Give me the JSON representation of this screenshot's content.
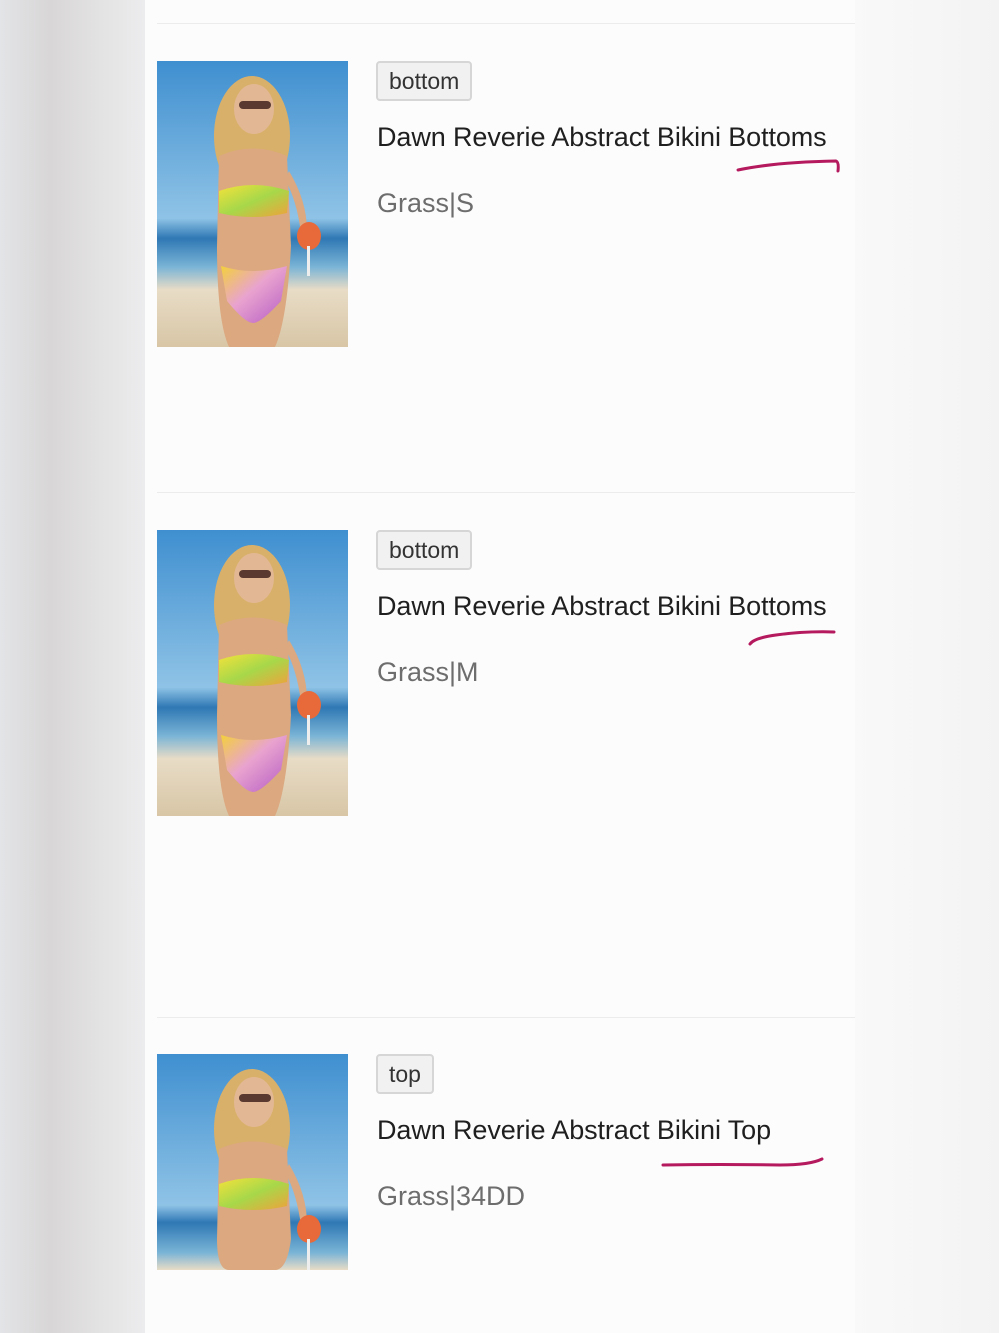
{
  "cart_items": [
    {
      "tag": "bottom",
      "title": "Dawn Reverie Abstract Bikini Bottoms",
      "variant": "Grass|S"
    },
    {
      "tag": "bottom",
      "title": "Dawn Reverie Abstract Bikini Bottoms",
      "variant": "Grass|M"
    },
    {
      "tag": "top",
      "title": "Dawn Reverie Abstract Bikini Top",
      "variant": "Grass|34DD"
    }
  ],
  "colors": {
    "annotation_stroke": "#b5195e",
    "tag_border": "#d6d6d6",
    "title_text": "#1f1f1f",
    "variant_text": "#6d6d6d"
  }
}
